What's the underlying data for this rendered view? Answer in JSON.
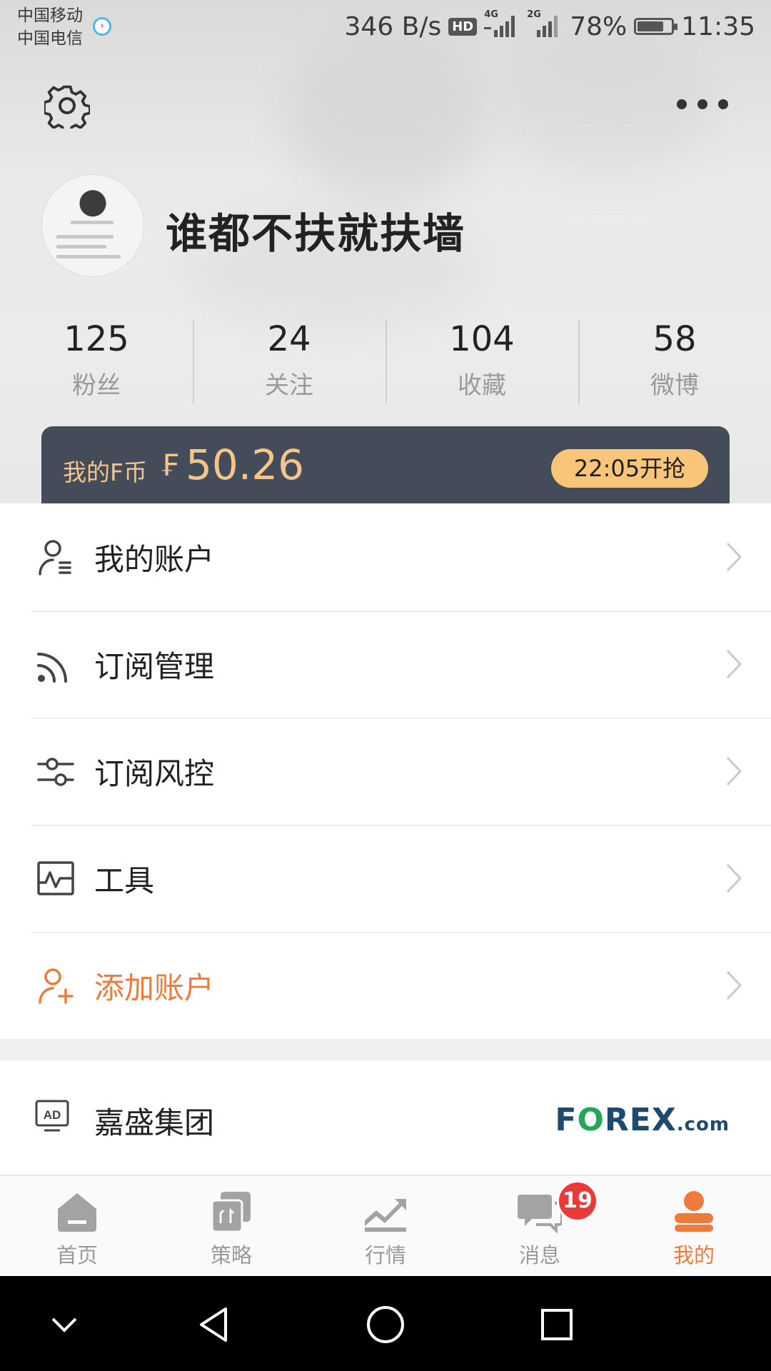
{
  "status_bar": {
    "carrier_1": "中国移动",
    "carrier_2": "中国电信",
    "net_speed": "346 B/s",
    "hd": "HD",
    "net_1": "4G",
    "net_2": "2G",
    "battery": "78%",
    "battery_level": 0.78,
    "time": "11:35"
  },
  "profile": {
    "username": "谁都不扶就扶墙"
  },
  "stats": [
    {
      "value": "125",
      "label": "粉丝"
    },
    {
      "value": "24",
      "label": "关注"
    },
    {
      "value": "104",
      "label": "收藏"
    },
    {
      "value": "58",
      "label": "微博"
    }
  ],
  "coin_card": {
    "label": "我的F币",
    "symbol": "₣",
    "value": "50.26",
    "button": "22:05开抢"
  },
  "menu": [
    {
      "label": "我的账户",
      "icon": "user-list-icon"
    },
    {
      "label": "订阅管理",
      "icon": "rss-icon"
    },
    {
      "label": "订阅风控",
      "icon": "sliders-icon"
    },
    {
      "label": "工具",
      "icon": "chart-pulse-icon"
    },
    {
      "label": "添加账户",
      "icon": "add-user-icon"
    }
  ],
  "ad": {
    "icon": "ad-icon",
    "label": "嘉盛集团",
    "brand_f": "F",
    "brand_o": "O",
    "brand_rest": "REX",
    "brand_suffix": ".com"
  },
  "tabbar": {
    "tabs": [
      {
        "label": "首页",
        "icon": "home-icon"
      },
      {
        "label": "策略",
        "icon": "strategy-icon"
      },
      {
        "label": "行情",
        "icon": "market-icon"
      },
      {
        "label": "消息",
        "icon": "message-icon",
        "badge": "19"
      },
      {
        "label": "我的",
        "icon": "profile-icon"
      }
    ],
    "active_color": "#f07a3a"
  },
  "colors": {
    "accent": "#f07a3a",
    "coin_card": "#454c59",
    "coin_text": "#f4c58a",
    "coin_button": "#f8c579",
    "badge": "#e93a3a"
  }
}
